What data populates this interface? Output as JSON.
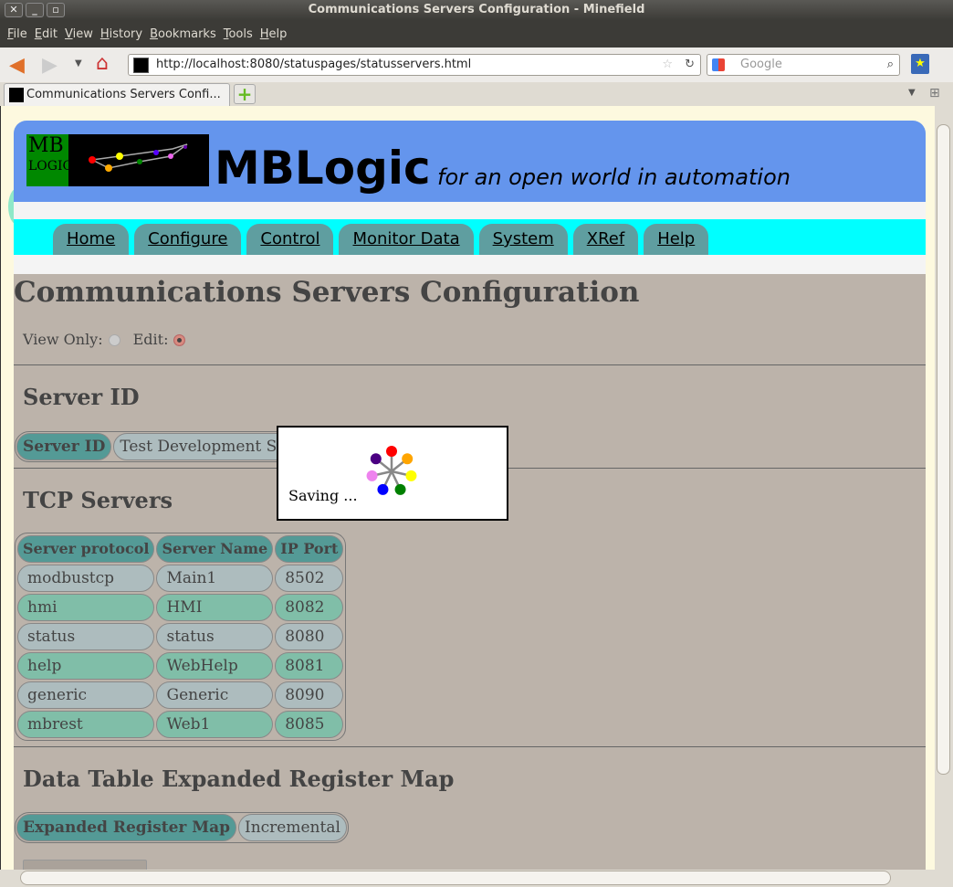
{
  "window": {
    "title": "Communications Servers Configuration - Minefield"
  },
  "menu": [
    "File",
    "Edit",
    "View",
    "History",
    "Bookmarks",
    "Tools",
    "Help"
  ],
  "toolbar": {
    "url": "http://localhost:8080/statuspages/statusservers.html",
    "search_placeholder": "Google"
  },
  "tab": {
    "label": "Communications Servers Confi..."
  },
  "header": {
    "brand": "MBLogic",
    "tagline": "for an open world in automation",
    "logo_text": "MB LOGIC for an open world in automation"
  },
  "nav": [
    "Home",
    "Configure",
    "Control",
    "Monitor Data",
    "System",
    "XRef",
    "Help"
  ],
  "page": {
    "title": "Communications Servers Configuration",
    "view_only_label": "View Only:",
    "edit_label": "Edit:",
    "mode": "edit"
  },
  "server_id": {
    "heading": "Server ID",
    "label": "Server ID",
    "value": "Test Development Server"
  },
  "tcp": {
    "heading": "TCP Servers",
    "columns": [
      "Server protocol",
      "Server Name",
      "IP Port"
    ],
    "rows": [
      [
        "modbustcp",
        "Main1",
        "8502"
      ],
      [
        "hmi",
        "HMI",
        "8082"
      ],
      [
        "status",
        "status",
        "8080"
      ],
      [
        "help",
        "WebHelp",
        "8081"
      ],
      [
        "generic",
        "Generic",
        "8090"
      ],
      [
        "mbrest",
        "Web1",
        "8085"
      ]
    ]
  },
  "regmap": {
    "heading": "Data Table Expanded Register Map",
    "label": "Expanded Register Map",
    "value": "Incremental"
  },
  "dialog": {
    "text": "Saving ...",
    "spinner_colors": [
      "#ff0000",
      "#ffa500",
      "#ffff00",
      "#008000",
      "#0000ff",
      "#ee82ee",
      "#4b0082"
    ]
  }
}
